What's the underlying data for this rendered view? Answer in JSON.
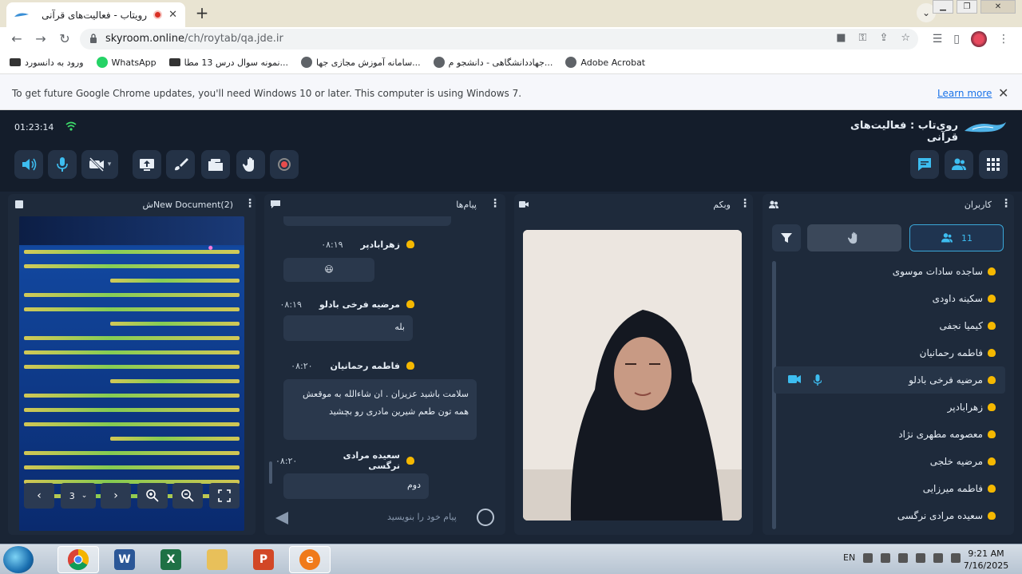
{
  "browser": {
    "tab_title": "رویتاب - فعالیت‌های قرآنی",
    "url_host": "skyroom.online",
    "url_path": "/ch/roytab/qa.jde.ir",
    "bookmarks": [
      "ورود به دانسورد",
      "WhatsApp",
      "نمونه سوال درس 13 مطا...",
      "سامانه آموزش مجازی جها...",
      "جهاددانشگاهی - دانشجو م...",
      "Adobe Acrobat"
    ],
    "infobar_text": "To get future Google Chrome updates, you'll need Windows 10 or later. This computer is using Windows 7.",
    "infobar_link": "Learn more"
  },
  "app": {
    "clock": "01:23:14",
    "title": "روی‌تاب : فعالیت‌های قرآنی"
  },
  "document_panel": {
    "title": "New Document(2)ش",
    "page": "3"
  },
  "messages_panel": {
    "title": "پیام‌ها",
    "input_placeholder": "پیام خود را بنویسید",
    "messages": [
      {
        "sender": "زهرابادپر",
        "time": "۰۸:۱۹",
        "text": "😃"
      },
      {
        "sender": "مرضیه فرخی بادلو",
        "time": "۰۸:۱۹",
        "text": "بله"
      },
      {
        "sender": "فاطمه رحمانیان",
        "time": "۰۸:۲۰",
        "text": "سلامت باشید عزیزان . ان شاءالله به موقعش همه تون طعم شیرین مادری رو بچشید"
      },
      {
        "sender": "سعیده مرادی نرگسی",
        "time": "۰۸:۲۰",
        "text": "دوم"
      }
    ]
  },
  "webcam_panel": {
    "title": "وبکم"
  },
  "users_panel": {
    "title": "کاربران",
    "count": "11",
    "users": [
      "ساجده سادات موسوی",
      "سکینه داودی",
      "کیمیا نجفی",
      "فاطمه رحمانیان",
      "مرضیه فرخی بادلو",
      "زهرابادپر",
      "معصومه مطهری نژاد",
      "مرضیه خلجی",
      "فاطمه میرزایی",
      "سعیده مرادی نرگسی"
    ]
  },
  "taskbar": {
    "lang": "EN",
    "time": "9:21 AM",
    "date": "7/16/2025"
  },
  "colors": {
    "accent": "#3dbdf0",
    "panel_bg": "#1e2a3b",
    "app_bg": "#141d2b",
    "user_icon": "#f5b800"
  }
}
